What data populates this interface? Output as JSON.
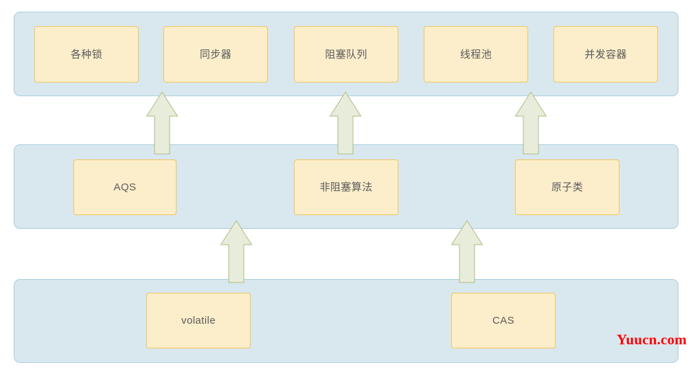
{
  "diagram": {
    "type": "layered-block-diagram",
    "background_color": "#ffffff",
    "layer_fill": "#d9e7ee",
    "layer_border": "#a9cede",
    "node_fill": "#fceecb",
    "node_border": "#f2c55c",
    "node_text_color": "#5a5a5a",
    "arrow_fill": "#e7ecdb",
    "arrow_border": "#aebd82"
  },
  "layers": [
    {
      "name": "top-layer",
      "nodes": [
        {
          "label": "各种锁"
        },
        {
          "label": "同步器"
        },
        {
          "label": "阻塞队列"
        },
        {
          "label": "线程池"
        },
        {
          "label": "并发容器"
        }
      ]
    },
    {
      "name": "middle-layer",
      "nodes": [
        {
          "label": "AQS"
        },
        {
          "label": "非阻塞算法"
        },
        {
          "label": "原子类"
        }
      ]
    },
    {
      "name": "bottom-layer",
      "nodes": [
        {
          "label": "volatile"
        },
        {
          "label": "CAS"
        }
      ]
    }
  ],
  "arrows": [
    {
      "name": "arrow-aqs-to-top",
      "direction": "up"
    },
    {
      "name": "arrow-nonblocking-to-top",
      "direction": "up"
    },
    {
      "name": "arrow-atomic-to-top",
      "direction": "up"
    },
    {
      "name": "arrow-volatile-to-aqs",
      "direction": "up"
    },
    {
      "name": "arrow-cas-to-nonblocking",
      "direction": "up"
    }
  ],
  "watermark": {
    "text": "Yuucn.com",
    "color": "#fe0000"
  }
}
